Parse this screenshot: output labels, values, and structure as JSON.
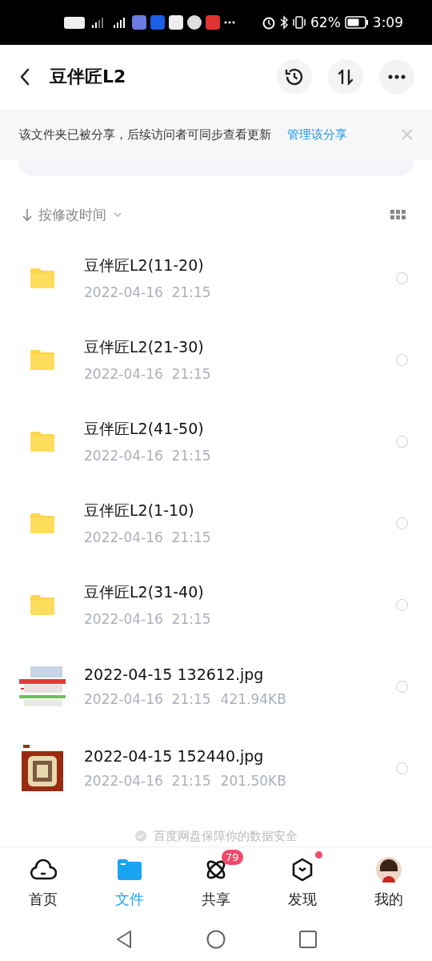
{
  "status_bar": {
    "battery_percent": "62%",
    "time": "3:09"
  },
  "header": {
    "title": "豆伴匠L2"
  },
  "banner": {
    "message": "该文件夹已被分享，后续访问者可同步查看更新",
    "link": "管理该分享"
  },
  "sort": {
    "label": "按修改时间"
  },
  "files": [
    {
      "kind": "folder",
      "name": "豆伴匠L2(11-20)",
      "date": "2022-04-16  21:15",
      "selected": false
    },
    {
      "kind": "folder",
      "name": "豆伴匠L2(21-30)",
      "date": "2022-04-16  21:15",
      "selected": false
    },
    {
      "kind": "folder",
      "name": "豆伴匠L2(41-50)",
      "date": "2022-04-16  21:15",
      "selected": false
    },
    {
      "kind": "folder",
      "name": "豆伴匠L2(1-10)",
      "date": "2022-04-16  21:15",
      "selected": false
    },
    {
      "kind": "folder",
      "name": "豆伴匠L2(31-40)",
      "date": "2022-04-16  21:15",
      "selected": false
    },
    {
      "kind": "sheet",
      "name": "2022-04-15 132612.jpg",
      "date": "2022-04-16  21:15",
      "size": "421.94KB",
      "selected": false
    },
    {
      "kind": "poster",
      "name": "2022-04-15 152440.jpg",
      "date": "2022-04-16  21:15",
      "size": "201.50KB",
      "selected": false
    }
  ],
  "footer_note": "百度网盘保障你的数据安全",
  "nav": [
    {
      "kind": "home",
      "label": "首页",
      "selected": false
    },
    {
      "kind": "files",
      "label": "文件",
      "selected": true
    },
    {
      "kind": "share",
      "label": "共享",
      "selected": false,
      "badge": "79"
    },
    {
      "kind": "discover",
      "label": "发现",
      "selected": false,
      "dot": true
    },
    {
      "kind": "me",
      "label": "我的",
      "selected": false
    }
  ]
}
